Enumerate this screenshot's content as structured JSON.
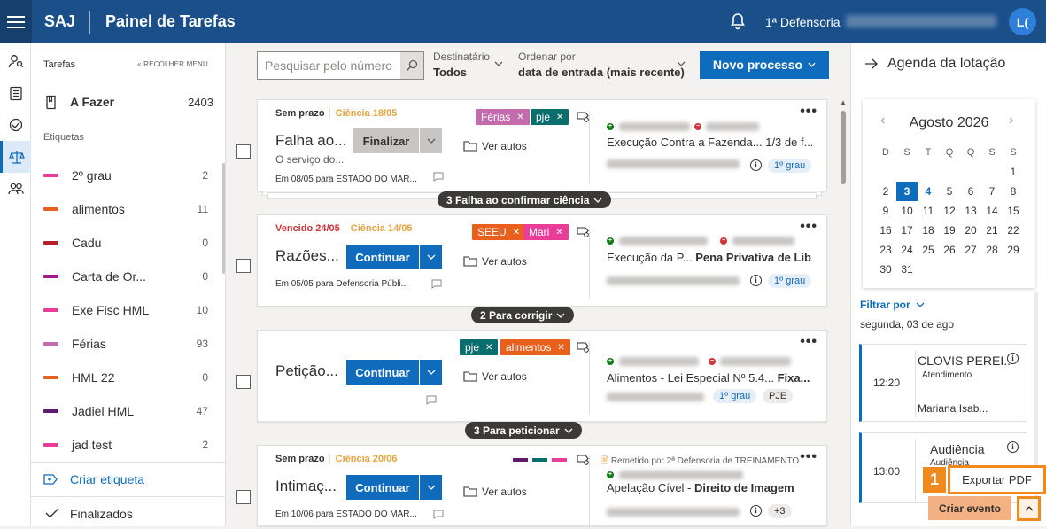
{
  "header": {
    "brand": "SAJ",
    "title": "Painel de Tarefas",
    "org": "1ª Defensoria",
    "avatar": "L("
  },
  "sidebar": {
    "section_title": "Tarefas",
    "collapse_label": "RECOLHER MENU",
    "afazer": {
      "label": "A Fazer",
      "count": "2403"
    },
    "tags_title": "Etiquetas",
    "tags": [
      {
        "name": "2º grau",
        "count": "2",
        "color": "#e83e9a"
      },
      {
        "name": "alimentos",
        "count": "11",
        "color": "#e8601c"
      },
      {
        "name": "Cadu",
        "count": "0",
        "color": "#b3202a"
      },
      {
        "name": "Carta de Or...",
        "count": "0",
        "color": "#a01c8c"
      },
      {
        "name": "Exe Fisc HML",
        "count": "10",
        "color": "#e83e9a"
      },
      {
        "name": "Férias",
        "count": "93",
        "color": "#c46bae"
      },
      {
        "name": "HML 22",
        "count": "0",
        "color": "#e8601c"
      },
      {
        "name": "Jadiel HML",
        "count": "47",
        "color": "#5c1a6e"
      },
      {
        "name": "jad test",
        "count": "2",
        "color": "#e83e9a"
      }
    ],
    "create_tag": "Criar etiqueta",
    "finished": "Finalizados"
  },
  "toolbar": {
    "search_placeholder": "Pesquisar pelo número",
    "dest_label": "Destinatário",
    "dest_value": "Todos",
    "order_label": "Ordenar por",
    "order_value": "data de entrada (mais recente)",
    "new_button": "Novo processo"
  },
  "cards": [
    {
      "status": "Sem prazo",
      "ciencia": "Ciência 18/05",
      "title": "Falha ao...",
      "subtitle": "O serviço do...",
      "action": "Finalizar",
      "tags": [
        "Férias",
        "pje"
      ],
      "autos": "Ver autos",
      "process": "Execução Contra a Fazenda... 1/3 de f...",
      "pills": [
        "1º grau"
      ],
      "date": "Em 08/05 para ESTADO DO MAR..."
    },
    {
      "status": "Vencido 24/05",
      "ciencia": "Ciência 14/05",
      "title": "Razões...",
      "action": "Continuar",
      "tags": [
        "SEEU",
        "Mari"
      ],
      "autos": "Ver autos",
      "process_a": "Execução da P... ",
      "process_b": "Pena Privativa de Lib...",
      "pills": [
        "1º grau"
      ],
      "date": "Em 05/05 para Defensoria Públi..."
    },
    {
      "title": "Petição...",
      "action": "Continuar",
      "tags": [
        "pje",
        "alimentos"
      ],
      "autos": "Ver autos",
      "process_a": "Alimentos - Lei Especial Nº 5.4... ",
      "process_b": "Fixa...",
      "pills": [
        "1º grau",
        "PJE"
      ]
    },
    {
      "status": "Sem prazo",
      "ciencia": "Ciência 20/06",
      "title": "Intimaç...",
      "action": "Continuar",
      "autos": "Ver autos",
      "remetido": "Remetido por  2ª Defensoria de TREINAMENTO",
      "process_a": "Apelação Cível - ",
      "process_b": "Direito de Imagem",
      "pills": [
        "+3"
      ],
      "date": "Em 10/06 para ESTADO DO MAR..."
    }
  ],
  "groups": [
    {
      "label": "3 Falha ao confirmar ciência"
    },
    {
      "label": "2 Para corrigir"
    },
    {
      "label": "3 Para peticionar"
    }
  ],
  "agenda": {
    "title": "Agenda da lotação",
    "month": "Agosto 2026",
    "weekdays": [
      "D",
      "S",
      "T",
      "Q",
      "Q",
      "S",
      "S"
    ],
    "filter": "Filtrar por",
    "day_label": "segunda, 03 de ago",
    "events": [
      {
        "time": "12:20",
        "title": "CLOVIS PEREI...",
        "type": "Atendimento",
        "person": "Mariana Isab..."
      },
      {
        "time": "13:00",
        "title": "Audiência",
        "type": "Audiência"
      }
    ],
    "export": "Exportar PDF",
    "create_event": "Criar evento",
    "step_number": "1"
  }
}
